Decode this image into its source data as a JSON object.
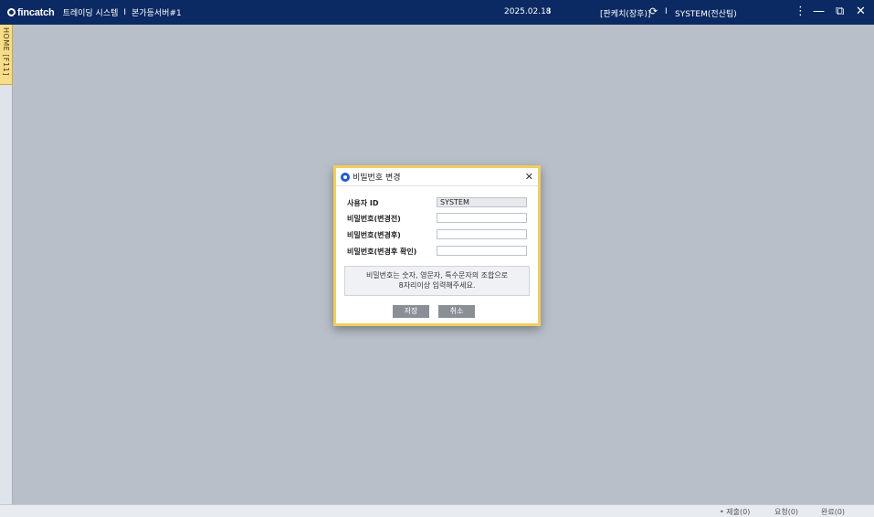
{
  "header": {
    "logo": "fincatch",
    "app_title": "트레이딩 시스템",
    "separator": "I",
    "server": "본가등서버#1",
    "date": "2025.02.18",
    "branch": "[판케치(장후)]",
    "user": "SYSTEM(전산팀)",
    "icons": {
      "refresh": "refresh-icon",
      "more": "more-vertical-icon",
      "minimize": "minimize-icon",
      "restore": "restore-icon",
      "close": "close-icon"
    }
  },
  "sidebar": {
    "home_tab": "HOME [F11]"
  },
  "dialog": {
    "title": "비밀번호 변경",
    "fields": [
      {
        "label": "사용자 ID",
        "value": "SYSTEM"
      },
      {
        "label": "비밀번호(변경전)",
        "value": ""
      },
      {
        "label": "비밀번호(변경후)",
        "value": ""
      },
      {
        "label": "비밀번호(변경후 확인)",
        "value": ""
      }
    ],
    "notice_line1": "비밀번호는 숫자, 영문자, 특수문자의 조합으로",
    "notice_line2": "8자리이상 입력해주세요.",
    "save_label": "저장",
    "cancel_label": "취소"
  },
  "statusbar": {
    "submit": "• 제출(0)",
    "request": "요청(0)",
    "complete": "완료(0)"
  },
  "colors": {
    "topbar": "#0b2a63",
    "workspace": "#b9bfc9",
    "dialog_border": "#f0cf5a",
    "button": "#8a8f96",
    "home_tab": "#f7dd8a"
  }
}
